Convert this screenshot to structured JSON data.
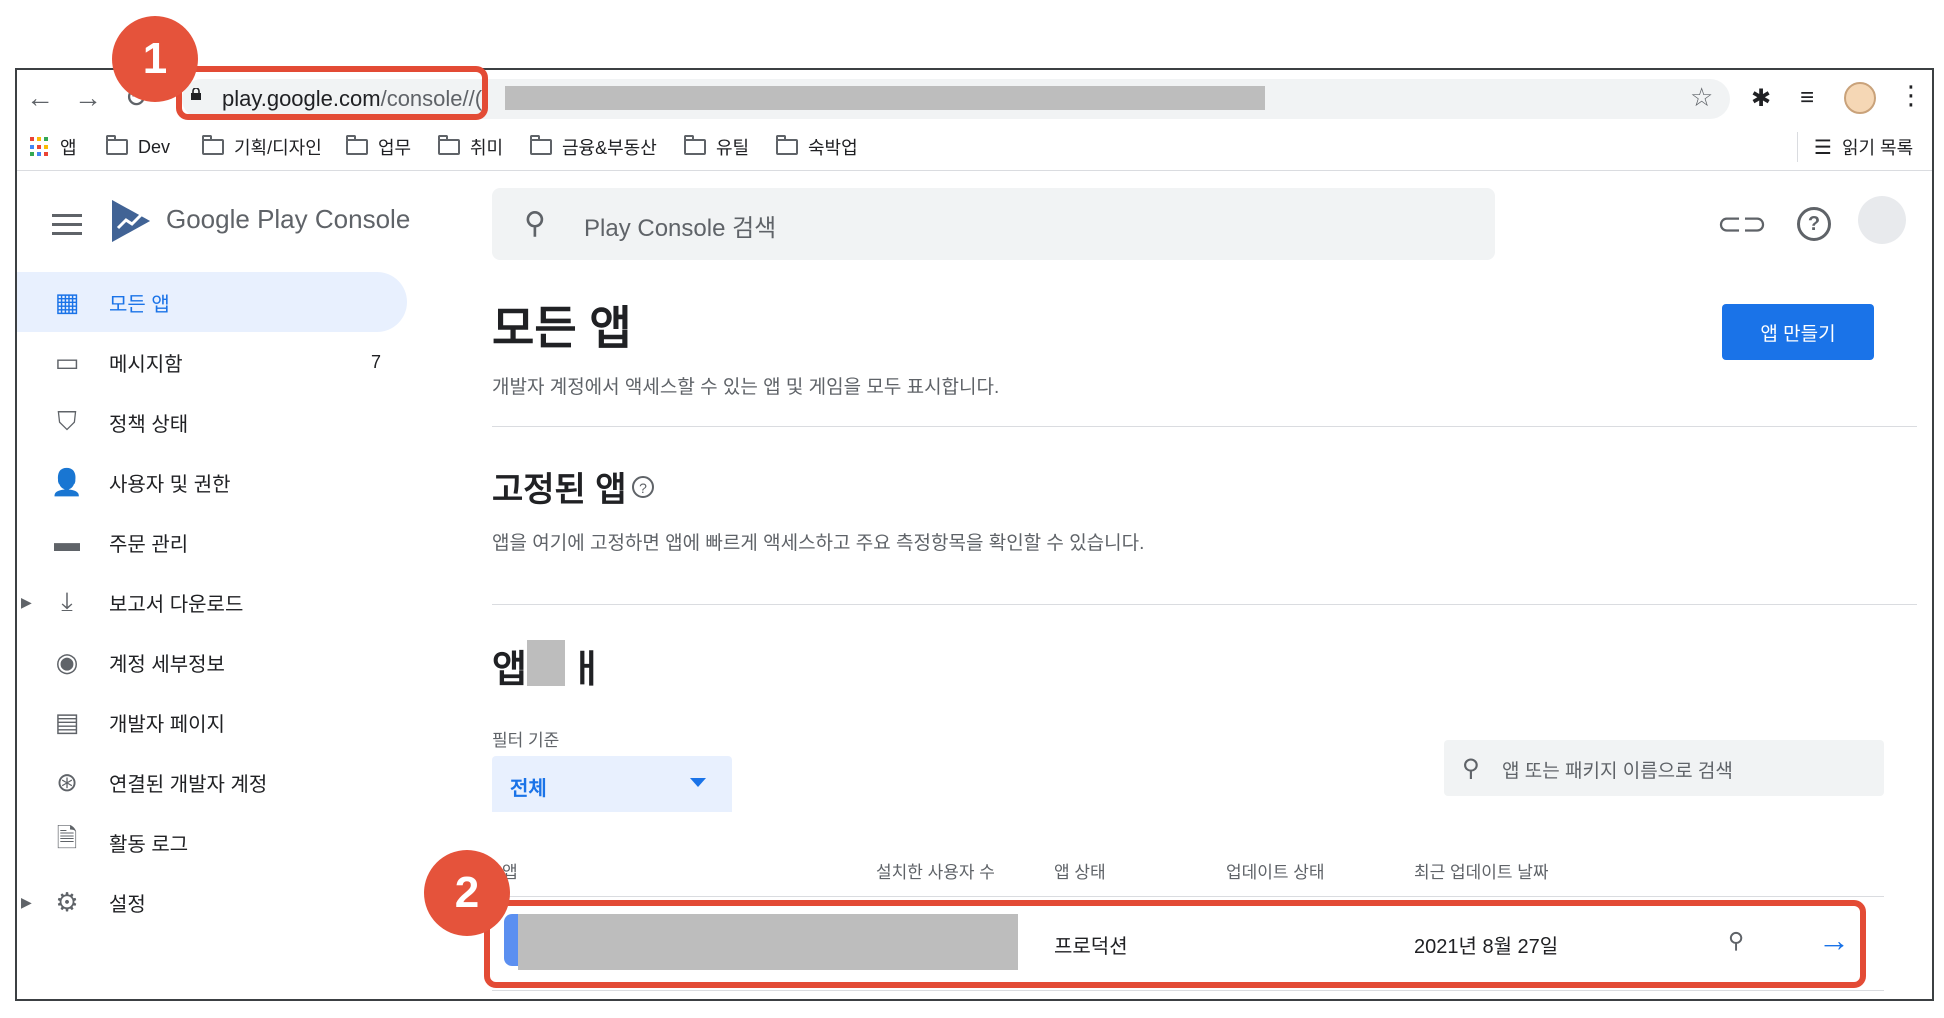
{
  "browser": {
    "url_host": "play.google.com",
    "url_path": "/console/",
    "url_tail": "/(",
    "bookmarks": [
      {
        "label": "앱",
        "icon": "apps-grid-icon"
      },
      {
        "label": "Dev",
        "icon": "folder-icon"
      },
      {
        "label": "기획/디자인",
        "icon": "folder-icon"
      },
      {
        "label": "업무",
        "icon": "folder-icon"
      },
      {
        "label": "취미",
        "icon": "folder-icon"
      },
      {
        "label": "금융&부동산",
        "icon": "folder-icon"
      },
      {
        "label": "유틸",
        "icon": "folder-icon"
      },
      {
        "label": "숙박업",
        "icon": "folder-icon"
      }
    ],
    "reading_list": "읽기 목록"
  },
  "header": {
    "logo_text_1": "Google Play",
    "logo_text_2": "Console",
    "search_placeholder": "Play Console 검색"
  },
  "sidebar": {
    "items": [
      {
        "label": "모든 앱",
        "icon": "grid-icon",
        "active": true
      },
      {
        "label": "메시지함",
        "icon": "inbox-icon",
        "count": "7"
      },
      {
        "label": "정책 상태",
        "icon": "shield-icon"
      },
      {
        "label": "사용자 및 권한",
        "icon": "people-icon"
      },
      {
        "label": "주문 관리",
        "icon": "credit-card-icon"
      },
      {
        "label": "보고서 다운로드",
        "icon": "download-icon",
        "expandable": true
      },
      {
        "label": "계정 세부정보",
        "icon": "account-circle-icon"
      },
      {
        "label": "개발자 페이지",
        "icon": "web-page-icon"
      },
      {
        "label": "연결된 개발자 계정",
        "icon": "linked-accounts-icon"
      },
      {
        "label": "활동 로그",
        "icon": "document-icon"
      },
      {
        "label": "설정",
        "icon": "settings-icon",
        "expandable": true
      }
    ]
  },
  "main": {
    "title": "모든 앱",
    "create_button": "앱 만들기",
    "subtitle": "개발자 계정에서 액세스할 수 있는 앱 및 게임을 모두 표시합니다.",
    "pinned_title": "고정된 앱",
    "pinned_desc": "앱을 여기에 고정하면 앱에 빠르게 액세스하고 주요 측정항목을 확인할 수 있습니다.",
    "apps_title_start": "앱",
    "apps_title_end": "ㅐ",
    "filter_label": "필터 기준",
    "filter_value": "전체",
    "app_search_placeholder": "앱 또는 패키지 이름으로 검색",
    "columns": [
      "앱",
      "설치한 사용자 수",
      "앱 상태",
      "업데이트 상태",
      "최근 업데이트 날짜"
    ],
    "rows": [
      {
        "app_status": "프로덕션",
        "last_updated": "2021년 8월 27일"
      }
    ]
  },
  "annotations": [
    "1",
    "2"
  ],
  "colors": {
    "accent": "#1a73e8",
    "annotation": "#e34b35"
  }
}
